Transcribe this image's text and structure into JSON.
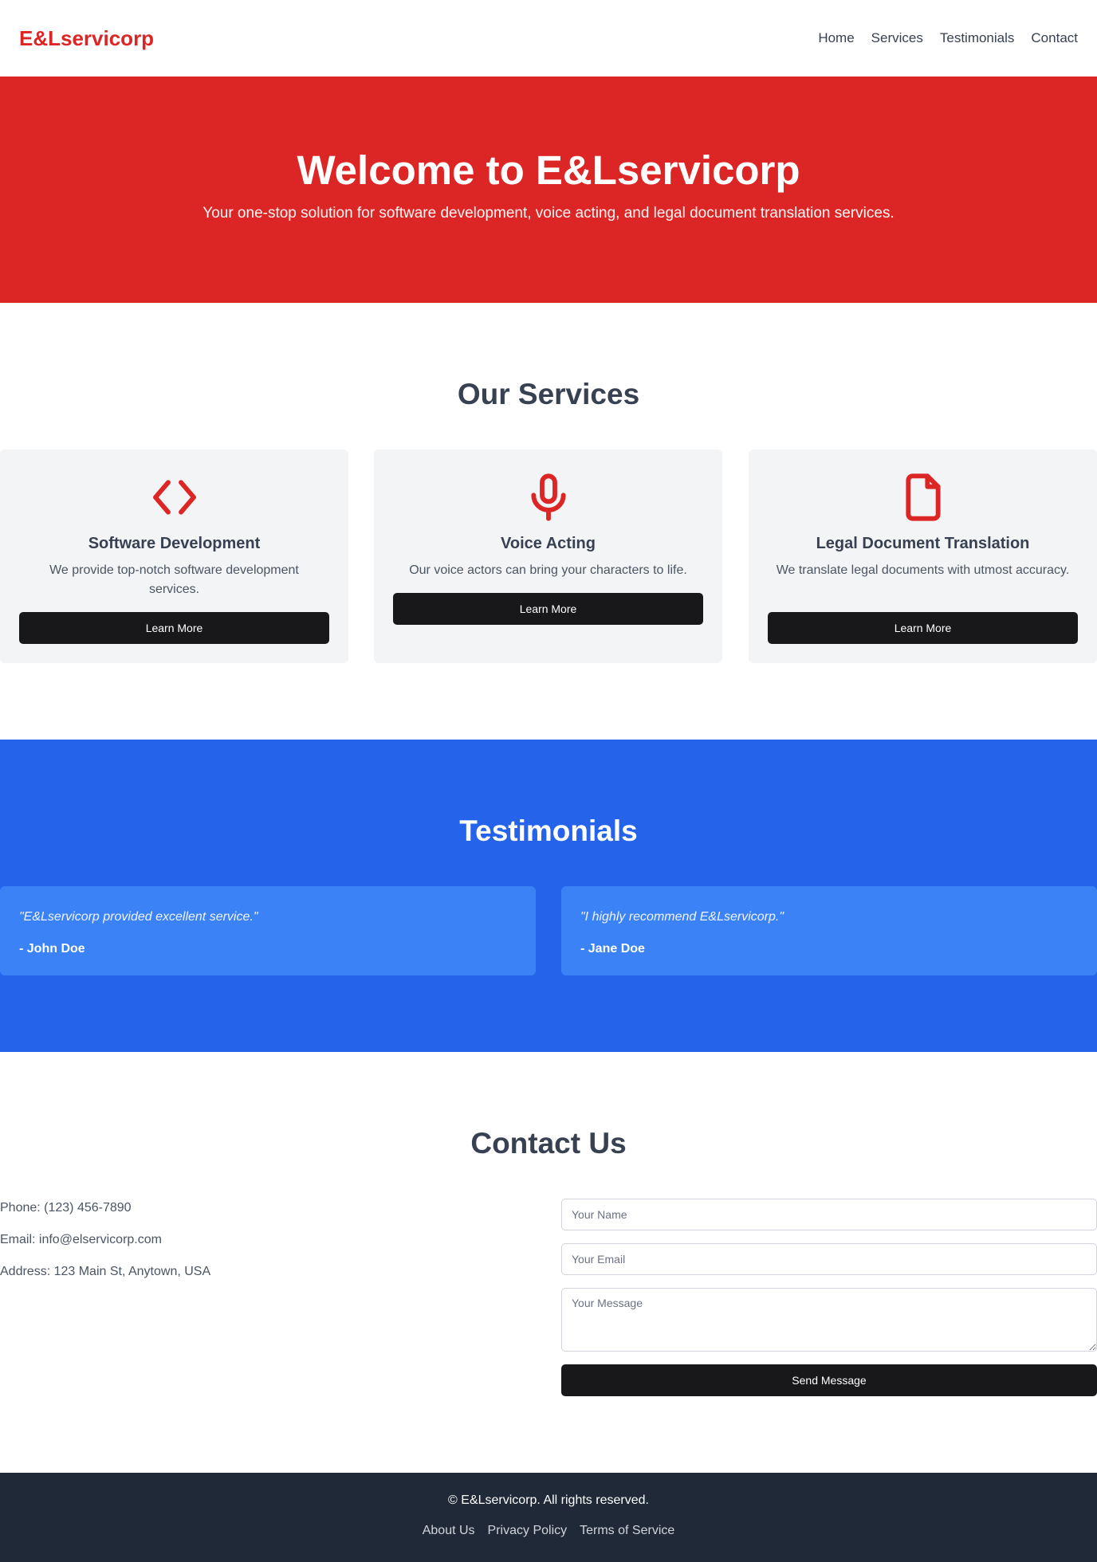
{
  "header": {
    "logo": "E&Lservicorp",
    "nav": [
      {
        "label": "Home"
      },
      {
        "label": "Services"
      },
      {
        "label": "Testimonials"
      },
      {
        "label": "Contact"
      }
    ]
  },
  "hero": {
    "title": "Welcome to E&Lservicorp",
    "subtitle": "Your one-stop solution for software development, voice acting, and legal document translation services."
  },
  "services": {
    "title": "Our Services",
    "items": [
      {
        "icon": "code-icon",
        "title": "Software Development",
        "description": "We provide top-notch software development services.",
        "button": "Learn More"
      },
      {
        "icon": "microphone-icon",
        "title": "Voice Acting",
        "description": "Our voice actors can bring your characters to life.",
        "button": "Learn More"
      },
      {
        "icon": "document-icon",
        "title": "Legal Document Translation",
        "description": "We translate legal documents with utmost accuracy.",
        "button": "Learn More"
      }
    ]
  },
  "testimonials": {
    "title": "Testimonials",
    "items": [
      {
        "quote": "\"E&Lservicorp provided excellent service.\"",
        "author": "- John Doe"
      },
      {
        "quote": "\"I highly recommend E&Lservicorp.\"",
        "author": "- Jane Doe"
      }
    ]
  },
  "contact": {
    "title": "Contact Us",
    "phone": "Phone: (123) 456-7890",
    "email": "Email: info@elservicorp.com",
    "address": "Address: 123 Main St, Anytown, USA",
    "form": {
      "name_placeholder": "Your Name",
      "email_placeholder": "Your Email",
      "message_placeholder": "Your Message",
      "submit": "Send Message"
    }
  },
  "footer": {
    "copyright": "© E&Lservicorp. All rights reserved.",
    "links": [
      {
        "label": "About Us"
      },
      {
        "label": "Privacy Policy"
      },
      {
        "label": "Terms of Service"
      }
    ]
  },
  "colors": {
    "brand_red": "#dc2626",
    "testimonial_blue": "#2563eb",
    "card_blue": "#3b82f6",
    "button_dark": "#18181b",
    "footer_bg": "#1f2937"
  }
}
